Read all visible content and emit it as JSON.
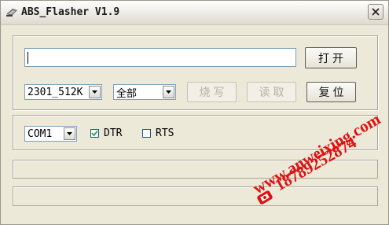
{
  "window": {
    "title": "ABS_Flasher V1.9"
  },
  "file": {
    "path_value": "",
    "open_label": "打开"
  },
  "chip": {
    "selected": "2301_512K"
  },
  "region": {
    "selected": "全部"
  },
  "actions": {
    "burn_label": "烧写",
    "read_label": "读取",
    "reset_label": "复位"
  },
  "serial": {
    "port": "COM1",
    "dtr_label": "DTR",
    "dtr_checked": true,
    "rts_label": "RTS",
    "rts_checked": false
  },
  "status": {
    "line1": "",
    "line2": ""
  },
  "watermark": {
    "url": "www.anweixing.com",
    "phone": "18789252874"
  },
  "colors": {
    "watermark": "#e01010",
    "window_bg": "#ece9d8"
  }
}
